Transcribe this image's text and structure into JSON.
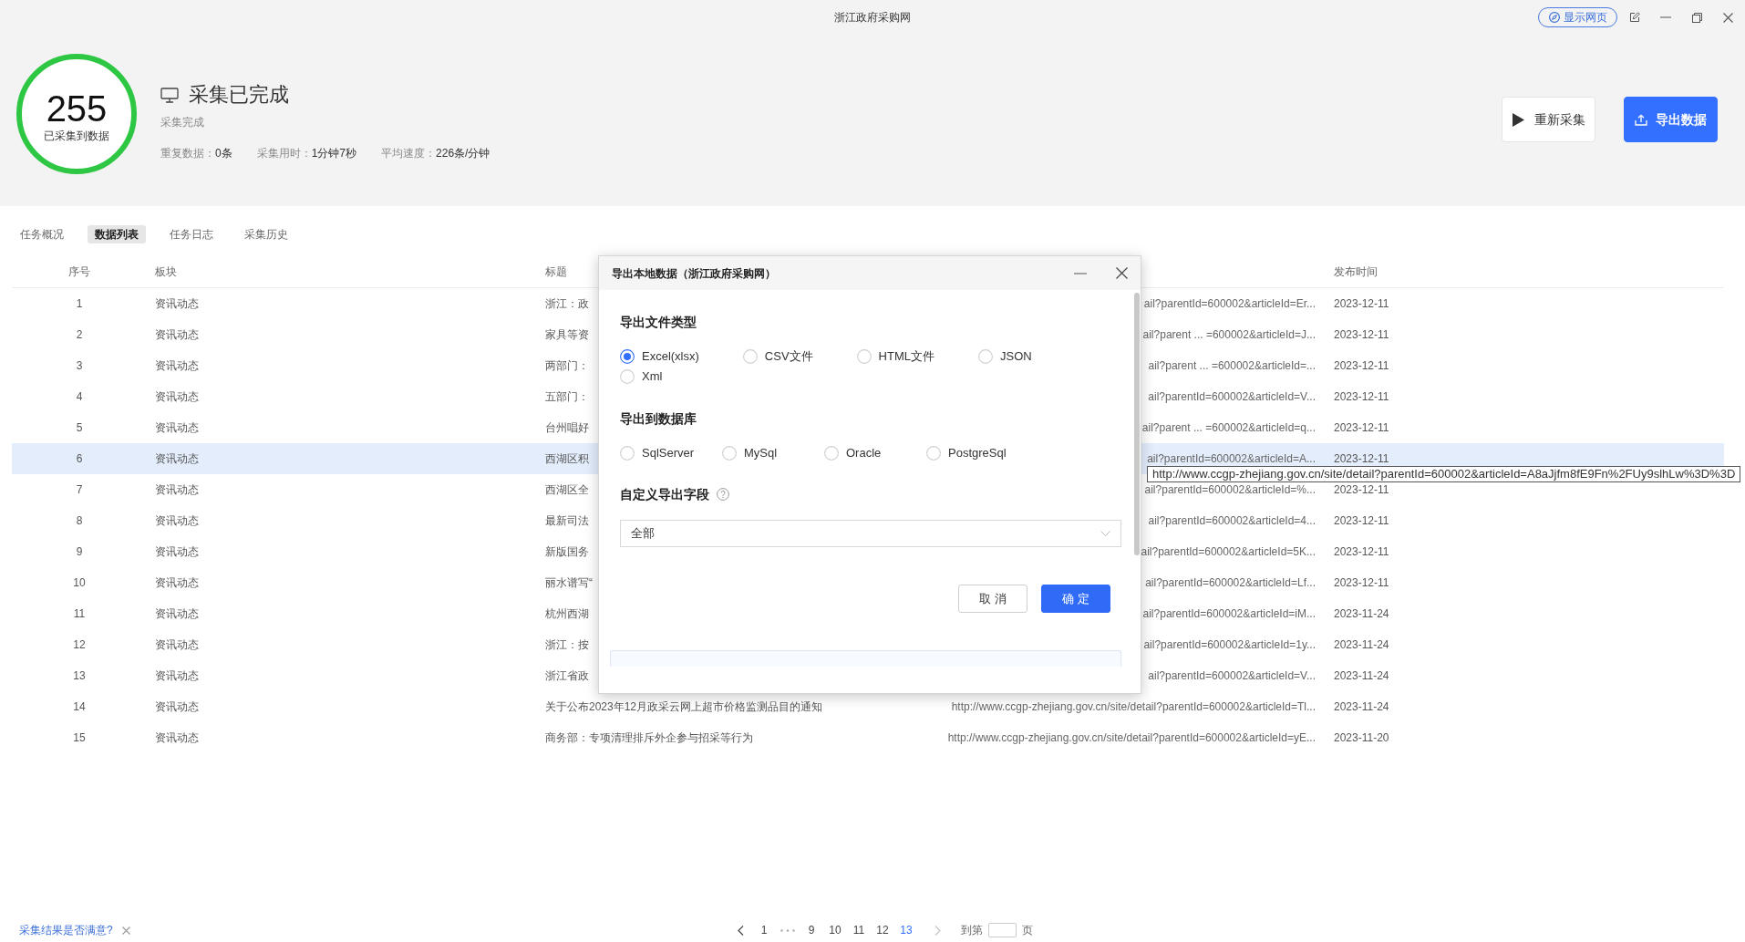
{
  "window": {
    "title": "浙江政府采购网",
    "web_button": "显示网页"
  },
  "summary": {
    "count": "255",
    "count_label": "已采集到数据",
    "status_title": "采集已完成",
    "status_subtitle": "采集完成",
    "stats": [
      {
        "label": "重复数据：",
        "value": "0条"
      },
      {
        "label": "采集用时：",
        "value": "1分钟7秒"
      },
      {
        "label": "平均速度：",
        "value": "226条/分钟"
      }
    ]
  },
  "actions": [
    {
      "kind": "restart",
      "label": "重新采集"
    },
    {
      "kind": "export",
      "label": "导出数据"
    }
  ],
  "tabs": [
    {
      "label": "任务概况",
      "selected": false
    },
    {
      "label": "数据列表",
      "selected": true
    },
    {
      "label": "任务日志",
      "selected": false
    },
    {
      "label": "采集历史",
      "selected": false
    }
  ],
  "table": {
    "columns": [
      "序号",
      "板块",
      "标题",
      "发布时间"
    ],
    "rows": [
      {
        "no": "1",
        "section": "资讯动态",
        "title": "浙江：政",
        "url": "ail?parentId=600002&articleId=Er...",
        "date": "2023-12-11",
        "selected": false
      },
      {
        "no": "2",
        "section": "资讯动态",
        "title": "家具等资",
        "url": "ail?parent ... =600002&articleId=J...",
        "date": "2023-12-11",
        "selected": false
      },
      {
        "no": "3",
        "section": "资讯动态",
        "title": "两部门：",
        "url": "ail?parent ... =600002&articleId=...",
        "date": "2023-12-11",
        "selected": false
      },
      {
        "no": "4",
        "section": "资讯动态",
        "title": "五部门：",
        "url": "ail?parentId=600002&articleId=V...",
        "date": "2023-12-11",
        "selected": false
      },
      {
        "no": "5",
        "section": "资讯动态",
        "title": "台州唱好",
        "url": "ail?parent ... =600002&articleId=q...",
        "date": "2023-12-11",
        "selected": false
      },
      {
        "no": "6",
        "section": "资讯动态",
        "title": "西湖区积",
        "url": "ail?parentId=600002&articleId=A...",
        "date": "2023-12-11",
        "selected": true
      },
      {
        "no": "7",
        "section": "资讯动态",
        "title": "西湖区全",
        "url": "ail?parentId=600002&articleId=%...",
        "date": "2023-12-11",
        "selected": false
      },
      {
        "no": "8",
        "section": "资讯动态",
        "title": "最新司法",
        "url": "ail?parentId=600002&articleId=4...",
        "date": "2023-12-11",
        "selected": false
      },
      {
        "no": "9",
        "section": "资讯动态",
        "title": "新版国务",
        "url": "ail?parentId=600002&articleId=5K...",
        "date": "2023-12-11",
        "selected": false
      },
      {
        "no": "10",
        "section": "资讯动态",
        "title": "丽水谱写“",
        "url": "ail?parentId=600002&articleId=Lf...",
        "date": "2023-12-11",
        "selected": false
      },
      {
        "no": "11",
        "section": "资讯动态",
        "title": "杭州西湖",
        "url": "ail?parentId=600002&articleId=iM...",
        "date": "2023-11-24",
        "selected": false
      },
      {
        "no": "12",
        "section": "资讯动态",
        "title": "浙江：按",
        "url": "ail?parentId=600002&articleId=1y...",
        "date": "2023-11-24",
        "selected": false
      },
      {
        "no": "13",
        "section": "资讯动态",
        "title": "浙江省政",
        "url": "ail?parentId=600002&articleId=V...",
        "date": "2023-11-24",
        "selected": false
      },
      {
        "no": "14",
        "section": "资讯动态",
        "title": "关于公布2023年12月政采云网上超市价格监测品目的通知",
        "url": "http://www.ccgp-zhejiang.gov.cn/site/detail?parentId=600002&articleId=Tl...",
        "date": "2023-11-24",
        "selected": false
      },
      {
        "no": "15",
        "section": "资讯动态",
        "title": "商务部：专项清理排斥外企参与招采等行为",
        "url": "http://www.ccgp-zhejiang.gov.cn/site/detail?parentId=600002&articleId=yE...",
        "date": "2023-11-20",
        "selected": false
      }
    ]
  },
  "export_dialog": {
    "title": "导出本地数据（浙江政府采购网）",
    "option_groups": [
      {
        "heading": "导出文件类型",
        "options": [
          {
            "label": "Excel(xlsx)",
            "selected": true
          },
          {
            "label": "CSV文件",
            "selected": false
          },
          {
            "label": "HTML文件",
            "selected": false
          },
          {
            "label": "JSON",
            "selected": false
          },
          {
            "label": "Xml",
            "selected": false
          }
        ]
      },
      {
        "heading": "导出到数据库",
        "options": [
          {
            "label": "SqlServer",
            "selected": false
          },
          {
            "label": "MySql",
            "selected": false
          },
          {
            "label": "Oracle",
            "selected": false
          },
          {
            "label": "PostgreSql",
            "selected": false
          }
        ]
      }
    ],
    "fields": {
      "heading": "自定义导出字段",
      "value": "全部"
    },
    "buttons": [
      {
        "kind": "cancel",
        "label": "取 消"
      },
      {
        "kind": "confirm",
        "label": "确 定"
      }
    ]
  },
  "url_tooltip": {
    "text": "http://www.ccgp-zhejiang.gov.cn/site/detail?parentId=600002&articleId=A8aJjfm8fE9Fn%2FUy9slhLw%3D%3D"
  },
  "feedback": {
    "question": "采集结果是否满意?"
  },
  "pagination": {
    "items": [
      {
        "kind": "prev",
        "disabled": false
      },
      {
        "kind": "page",
        "label": "1",
        "selected": false
      },
      {
        "kind": "ellipsis"
      },
      {
        "kind": "page",
        "label": "9",
        "selected": false
      },
      {
        "kind": "page",
        "label": "10",
        "selected": false
      },
      {
        "kind": "page",
        "label": "11",
        "selected": false
      },
      {
        "kind": "page",
        "label": "12",
        "selected": false
      },
      {
        "kind": "page",
        "label": "13",
        "selected": true
      },
      {
        "kind": "next",
        "disabled": true
      }
    ],
    "jump_prefix": "到第",
    "jump_suffix": "页"
  }
}
